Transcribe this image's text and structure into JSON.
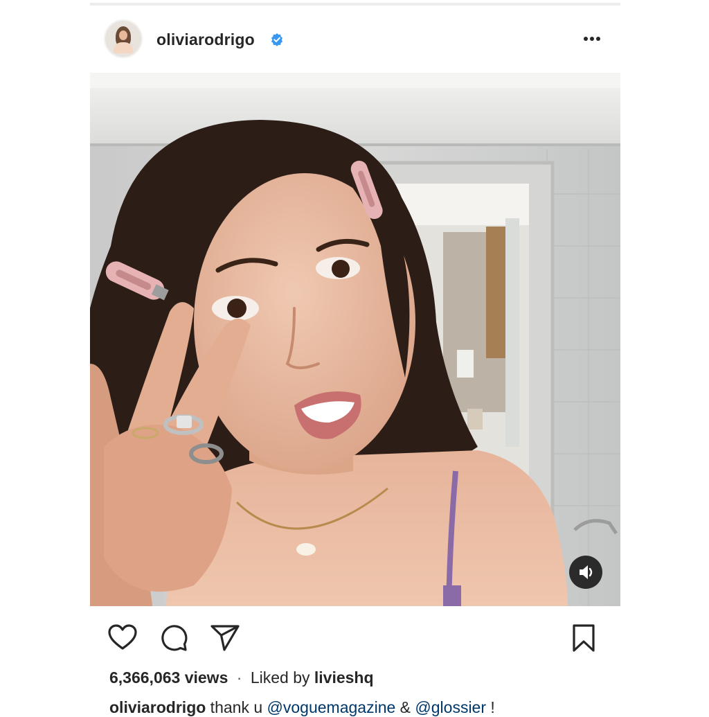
{
  "post": {
    "username": "oliviarodrigo",
    "verified": true,
    "views": "6,366,063 views",
    "separator": "·",
    "liked_prefix": "Liked by ",
    "liked_by": "livieshq",
    "caption": {
      "username": "oliviarodrigo",
      "text": " thank u ",
      "mention_1": "@voguemagazine",
      "joiner": " & ",
      "mention_2": "@glossier",
      "tail": " !"
    }
  },
  "icons": {
    "more": "more-horizontal-icon",
    "verified": "verified-badge-icon",
    "like": "heart-icon",
    "comment": "comment-icon",
    "share": "paper-plane-icon",
    "save": "bookmark-icon",
    "sound": "speaker-icon"
  },
  "colors": {
    "verified_blue": "#3897f0",
    "text": "#262626",
    "mention": "#00376b"
  }
}
